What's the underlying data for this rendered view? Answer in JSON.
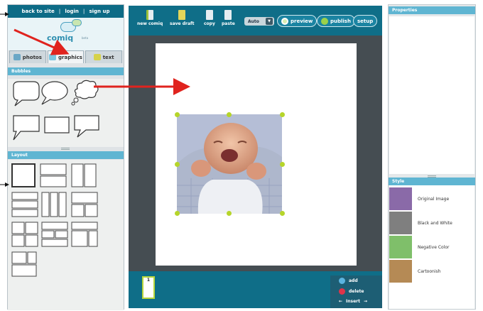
{
  "topnav": {
    "back": "back to site",
    "login": "login",
    "signup": "sign up",
    "sep": "|"
  },
  "logo": {
    "text": "comiq",
    "beta": "beta"
  },
  "tabs": [
    {
      "label": "photos",
      "icon": "photos-icon",
      "color": "#6aa7c6"
    },
    {
      "label": "graphics",
      "icon": "graphics-icon",
      "color": "#7cc6e0"
    },
    {
      "label": "text",
      "icon": "text-icon",
      "color": "#d6d24a"
    }
  ],
  "panels": {
    "bubbles": "Bubbles",
    "layout": "Layout",
    "properties": "Properties",
    "style": "Style"
  },
  "toolbar": {
    "new_comiq": "new comiq",
    "save_draft": "save draft",
    "copy": "copy",
    "paste": "paste",
    "auto": "Auto",
    "preview": "preview",
    "publish": "publish",
    "setup": "setup"
  },
  "strip": {
    "frame_number": "1",
    "add": "add",
    "delete": "delete",
    "insert": "Insert"
  },
  "styles": [
    {
      "label": "Original Image",
      "color": "#8a6aa8"
    },
    {
      "label": "Black and White",
      "color": "#7f7f7f"
    },
    {
      "label": "Negative Color",
      "color": "#7fbf6a"
    },
    {
      "label": "Cartoonish",
      "color": "#b58a55"
    }
  ],
  "colors": {
    "teal": "#0f6e88",
    "panel_head": "#5fb5d2",
    "handle": "#b6d52a",
    "arrow": "#e0231e"
  }
}
